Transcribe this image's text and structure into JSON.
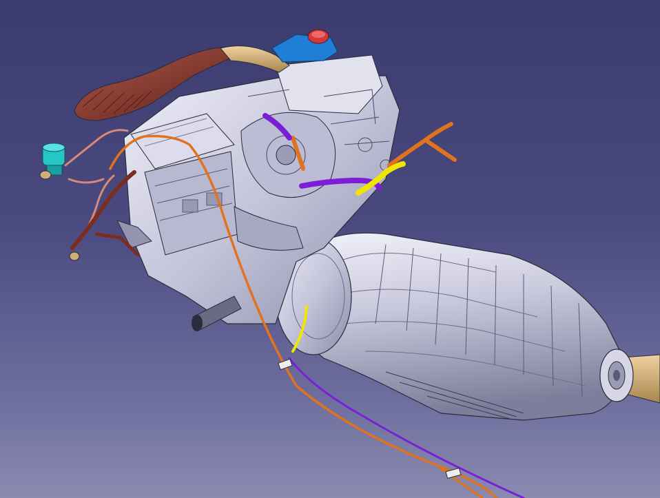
{
  "viewer": {
    "background_top": "#3b3b6e",
    "background_bottom": "#8a8ab0"
  },
  "model": {
    "colors": {
      "body": "#c9c9dd",
      "body_dark": "#8a8aa6",
      "body_light": "#e8e8f4",
      "edge": "#2a2a3a",
      "intake_duct": "#7a2e22",
      "intake_duct_light": "#a8564a",
      "beige_duct": "#cfae7a",
      "reservoir_blue": "#1e7fd6",
      "reservoir_cap": "#d23a3a",
      "hose_orange": "#e0731e",
      "hose_purple": "#7b1fd6",
      "hose_yellow": "#f2e600",
      "canister_cyan": "#27c6c6",
      "wire_pink": "#d88a7a"
    }
  }
}
